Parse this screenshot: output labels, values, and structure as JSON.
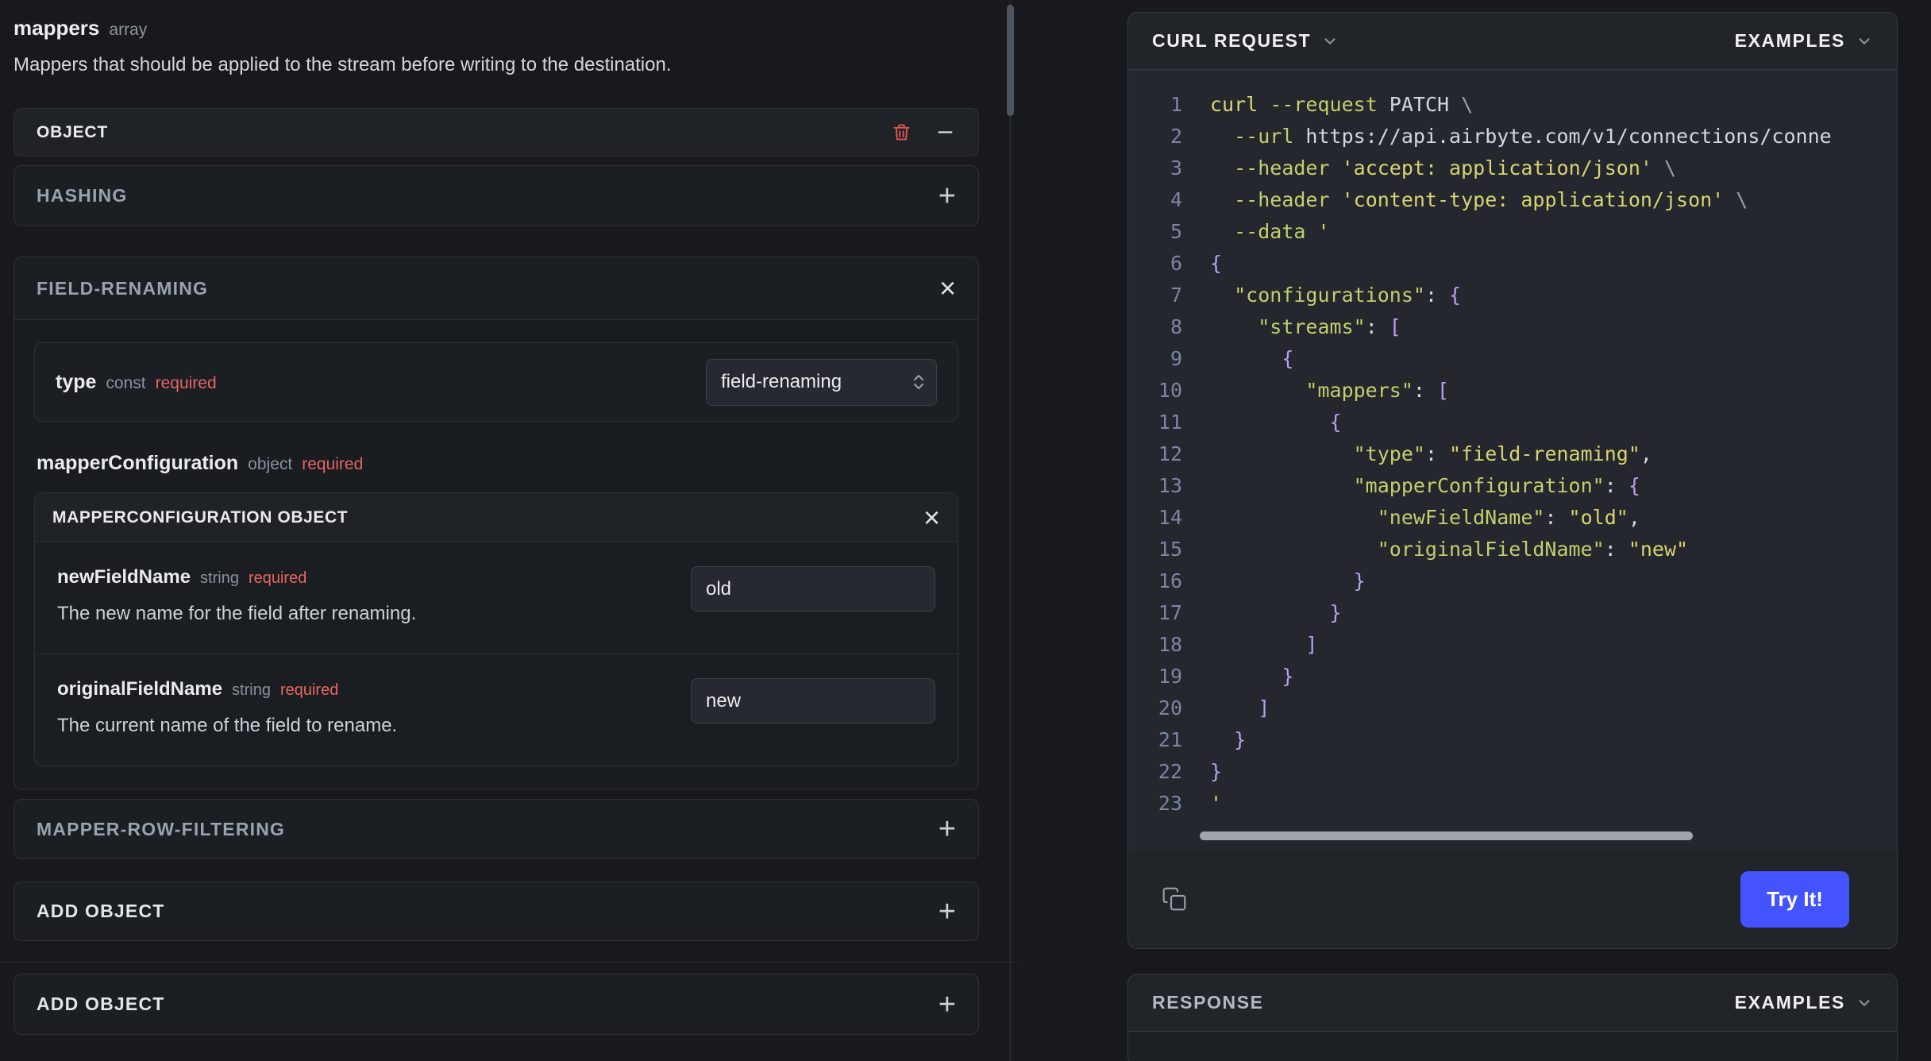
{
  "schema": {
    "title": "mappers",
    "title_kind": "array",
    "description": "Mappers that should be applied to the stream before writing to the destination.",
    "object_header": "OBJECT",
    "sections": {
      "hashing": "HASHING",
      "field_renaming": "FIELD-RENAMING",
      "mapper_row_filtering": "MAPPER-ROW-FILTERING",
      "add_object": "ADD OBJECT",
      "add_object_outer": "ADD OBJECT"
    },
    "type_field": {
      "name": "type",
      "kind": "const",
      "required_label": "required",
      "value": "field-renaming"
    },
    "mapper_configuration": {
      "name": "mapperConfiguration",
      "kind": "object",
      "required_label": "required",
      "panel_title": "MAPPERCONFIGURATION OBJECT",
      "fields": [
        {
          "name": "newFieldName",
          "kind": "string",
          "required_label": "required",
          "value": "old",
          "description": "The new name for the field after renaming."
        },
        {
          "name": "originalFieldName",
          "kind": "string",
          "required_label": "required",
          "value": "new",
          "description": "The current name of the field to rename."
        }
      ]
    }
  },
  "request_panel": {
    "title": "CURL REQUEST",
    "examples_label": "EXAMPLES",
    "try_button_label": "Try It!",
    "code_lines": [
      "curl --request PATCH \\",
      "  --url https://api.airbyte.com/v1/connections/conne",
      "  --header 'accept: application/json' \\",
      "  --header 'content-type: application/json' \\",
      "  --data '",
      "{",
      "  \"configurations\": {",
      "    \"streams\": [",
      "      {",
      "        \"mappers\": [",
      "          {",
      "            \"type\": \"field-renaming\",",
      "            \"mapperConfiguration\": {",
      "              \"newFieldName\": \"old\",",
      "              \"originalFieldName\": \"new\"",
      "            }",
      "          }",
      "        ]",
      "      }",
      "    ]",
      "  }",
      "}",
      "'"
    ]
  },
  "response_panel": {
    "title": "RESPONSE",
    "examples_label": "EXAMPLES"
  },
  "colors": {
    "accent_button": "#4353ff",
    "required": "#e8655f",
    "delete_icon": "#dd524c"
  }
}
